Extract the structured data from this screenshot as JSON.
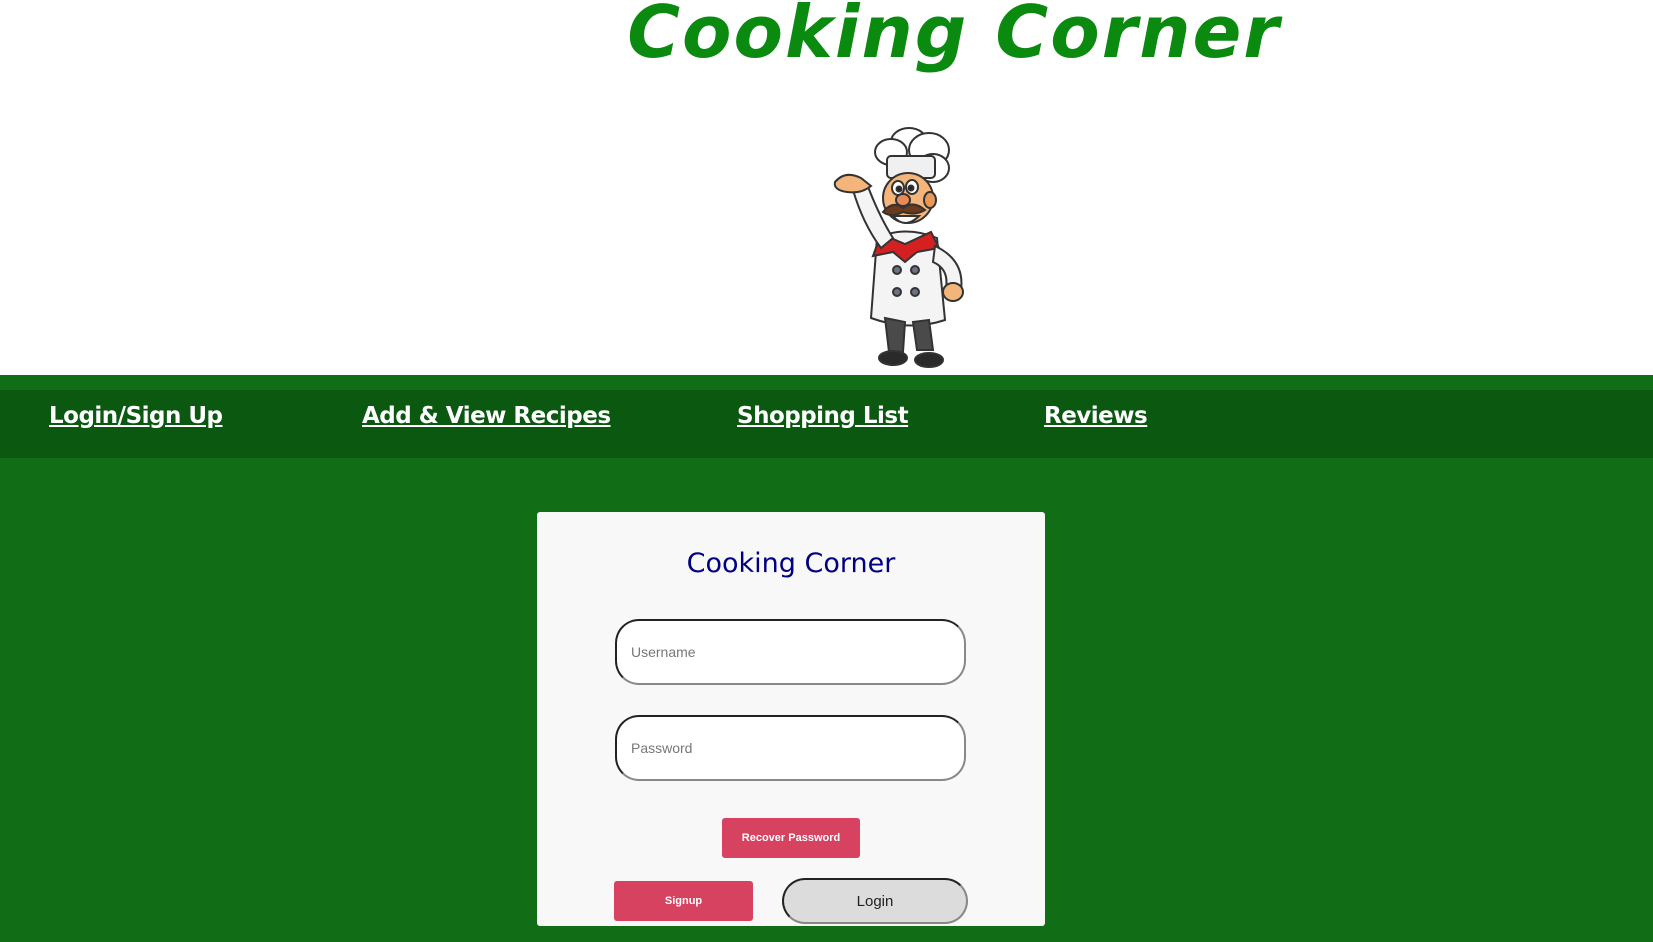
{
  "header": {
    "site_title": "Cooking Corner"
  },
  "nav": {
    "items": [
      {
        "label": "Login/Sign Up"
      },
      {
        "label": "Add & View Recipes"
      },
      {
        "label": "Shopping List"
      },
      {
        "label": "Reviews"
      }
    ]
  },
  "login_form": {
    "title": "Cooking Corner",
    "username_placeholder": "Username",
    "password_placeholder": "Password",
    "recover_label": "Recover Password",
    "signup_label": "Signup",
    "login_label": "Login"
  },
  "colors": {
    "title_green": "#0b8a10",
    "page_green": "#116e17",
    "nav_green": "#0b5811",
    "button_red": "#d64260",
    "card_title_navy": "#000080"
  },
  "icons": {
    "chef_mascot": "chef-illustration"
  }
}
